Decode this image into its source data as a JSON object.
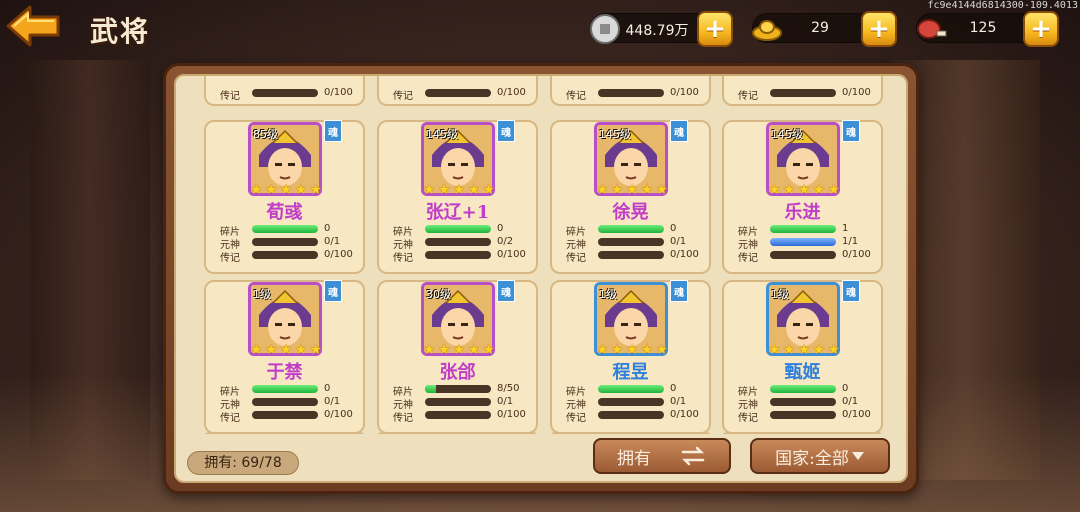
{
  "header": {
    "title": "武将",
    "debug_id": "fc9e4144d6814300-109.4013"
  },
  "currencies": [
    {
      "icon": "silver-coin-icon",
      "value": "448.79万"
    },
    {
      "icon": "gold-ingot-icon",
      "value": "29"
    },
    {
      "icon": "meat-stamina-icon",
      "value": "125"
    }
  ],
  "stat_labels": {
    "fragments": "碎片",
    "spirit": "元神",
    "biography": "传记"
  },
  "badge_text": "魂",
  "partial_row": [
    {
      "label": "传记",
      "value": "0/100"
    },
    {
      "label": "传记",
      "value": "0/100"
    },
    {
      "label": "传记",
      "value": "0/100"
    },
    {
      "label": "传记",
      "value": "0/100"
    }
  ],
  "heroes": [
    {
      "name": "荀彧",
      "level": "85级",
      "name_color": "#c23cc9",
      "frame_color": "#b94fc8",
      "stars": 5,
      "fragments": "0",
      "fragments_fill": 1.0,
      "spirit": "0/1",
      "spirit_fill": 0,
      "bio": "0/100",
      "bio_fill": 0
    },
    {
      "name": "张辽+1",
      "level": "145级",
      "name_color": "#c23cc9",
      "frame_color": "#b94fc8",
      "stars": 5,
      "fragments": "0",
      "fragments_fill": 1.0,
      "spirit": "0/2",
      "spirit_fill": 0,
      "bio": "0/100",
      "bio_fill": 0
    },
    {
      "name": "徐晃",
      "level": "145级",
      "name_color": "#c23cc9",
      "frame_color": "#b94fc8",
      "stars": 5,
      "fragments": "0",
      "fragments_fill": 1.0,
      "spirit": "0/1",
      "spirit_fill": 0,
      "bio": "0/100",
      "bio_fill": 0
    },
    {
      "name": "乐进",
      "level": "145级",
      "name_color": "#c23cc9",
      "frame_color": "#b94fc8",
      "stars": 5,
      "fragments": "1",
      "fragments_fill": 1.0,
      "spirit": "1/1",
      "spirit_fill": 1.0,
      "spirit_blue": true,
      "bio": "0/100",
      "bio_fill": 0
    },
    {
      "name": "于禁",
      "level": "1级",
      "name_color": "#c23cc9",
      "frame_color": "#b94fc8",
      "stars": 5,
      "fragments": "0",
      "fragments_fill": 1.0,
      "spirit": "0/1",
      "spirit_fill": 0,
      "bio": "0/100",
      "bio_fill": 0
    },
    {
      "name": "张郃",
      "level": "30级",
      "name_color": "#c23cc9",
      "frame_color": "#b94fc8",
      "stars": 5,
      "fragments": "8/50",
      "fragments_fill": 0.16,
      "spirit": "0/1",
      "spirit_fill": 0,
      "bio": "0/100",
      "bio_fill": 0
    },
    {
      "name": "程昱",
      "level": "1级",
      "name_color": "#2f7fdc",
      "frame_color": "#3d8fd6",
      "stars": 5,
      "fragments": "0",
      "fragments_fill": 1.0,
      "spirit": "0/1",
      "spirit_fill": 0,
      "bio": "0/100",
      "bio_fill": 0
    },
    {
      "name": "甄姬",
      "level": "1级",
      "name_color": "#2f7fdc",
      "frame_color": "#3d8fd6",
      "stars": 5,
      "fragments": "0",
      "fragments_fill": 1.0,
      "spirit": "0/1",
      "spirit_fill": 0,
      "bio": "0/100",
      "bio_fill": 0
    }
  ],
  "footer": {
    "owned_label": "拥有: 69/78",
    "sort_button": "拥有",
    "country_filter": "国家:全部"
  },
  "colors": {
    "accent_gold": "#f7b91f",
    "panel_brown": "#6b3c22",
    "parchment": "#efe0bd"
  }
}
